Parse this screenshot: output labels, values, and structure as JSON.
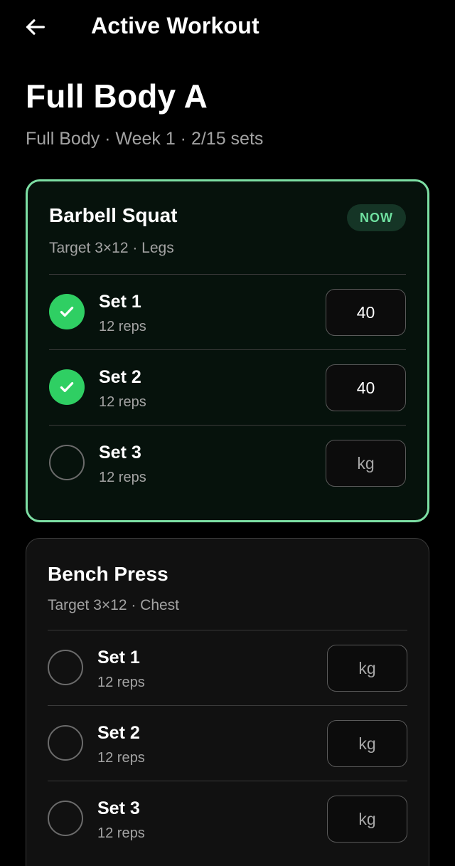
{
  "header": {
    "title": "Active Workout",
    "back_icon": "arrow-left-icon"
  },
  "workout": {
    "name": "Full Body A",
    "meta": "Full Body · Week 1 · 2/15 sets"
  },
  "exercises": [
    {
      "name": "Barbell Squat",
      "target": "Target 3×12 · Legs",
      "badge": "NOW",
      "sets": [
        {
          "label": "Set 1",
          "reps": "12 reps",
          "weight": "40",
          "placeholder": "kg",
          "done": true
        },
        {
          "label": "Set 2",
          "reps": "12 reps",
          "weight": "40",
          "placeholder": "kg",
          "done": true
        },
        {
          "label": "Set 3",
          "reps": "12 reps",
          "weight": "",
          "placeholder": "kg",
          "done": false
        }
      ]
    },
    {
      "name": "Bench Press",
      "target": "Target 3×12 · Chest",
      "sets": [
        {
          "label": "Set 1",
          "reps": "12 reps",
          "weight": "",
          "placeholder": "kg",
          "done": false
        },
        {
          "label": "Set 2",
          "reps": "12 reps",
          "weight": "",
          "placeholder": "kg",
          "done": false
        },
        {
          "label": "Set 3",
          "reps": "12 reps",
          "weight": "",
          "placeholder": "kg",
          "done": false
        }
      ]
    }
  ],
  "colors": {
    "background": "#000000",
    "accent": "#7ddfa4",
    "check_done": "#2fcf63",
    "badge_bg": "#153526",
    "muted_text": "#a3a3a3"
  }
}
